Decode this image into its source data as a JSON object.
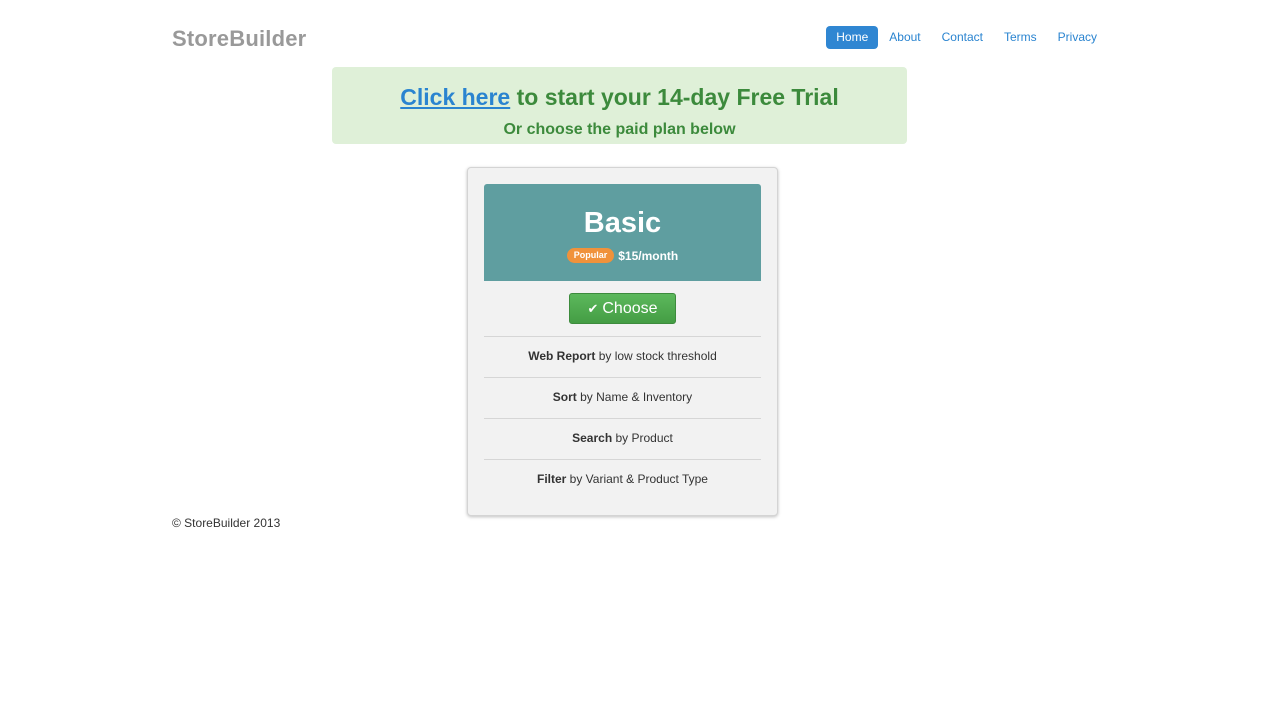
{
  "header": {
    "brand": "StoreBuilder",
    "nav": [
      {
        "label": "Home",
        "active": true
      },
      {
        "label": "About",
        "active": false
      },
      {
        "label": "Contact",
        "active": false
      },
      {
        "label": "Terms",
        "active": false
      },
      {
        "label": "Privacy",
        "active": false
      }
    ]
  },
  "banner": {
    "link_text": "Click here",
    "headline_rest": " to start your 14-day Free Trial",
    "subline": "Or choose the paid plan below"
  },
  "plan": {
    "name": "Basic",
    "badge": "Popular",
    "price": "$15/month",
    "choose_label": "Choose",
    "choose_icon": "checkmark-icon",
    "features": [
      {
        "bold": "Web Report",
        "rest": " by low stock threshold"
      },
      {
        "bold": "Sort",
        "rest": " by Name & Inventory"
      },
      {
        "bold": "Search",
        "rest": " by Product"
      },
      {
        "bold": "Filter",
        "rest": " by Variant & Product Type"
      }
    ]
  },
  "footer": {
    "text": "© StoreBuilder 2013"
  },
  "colors": {
    "nav_active_bg": "#2f86d2",
    "link": "#2a84d0",
    "banner_bg": "#dff0d8",
    "banner_text": "#3c8a3c",
    "plan_header_bg": "#5f9ea0",
    "badge_bg": "#f0923b",
    "choose_btn_bg": "#5cb85c"
  }
}
